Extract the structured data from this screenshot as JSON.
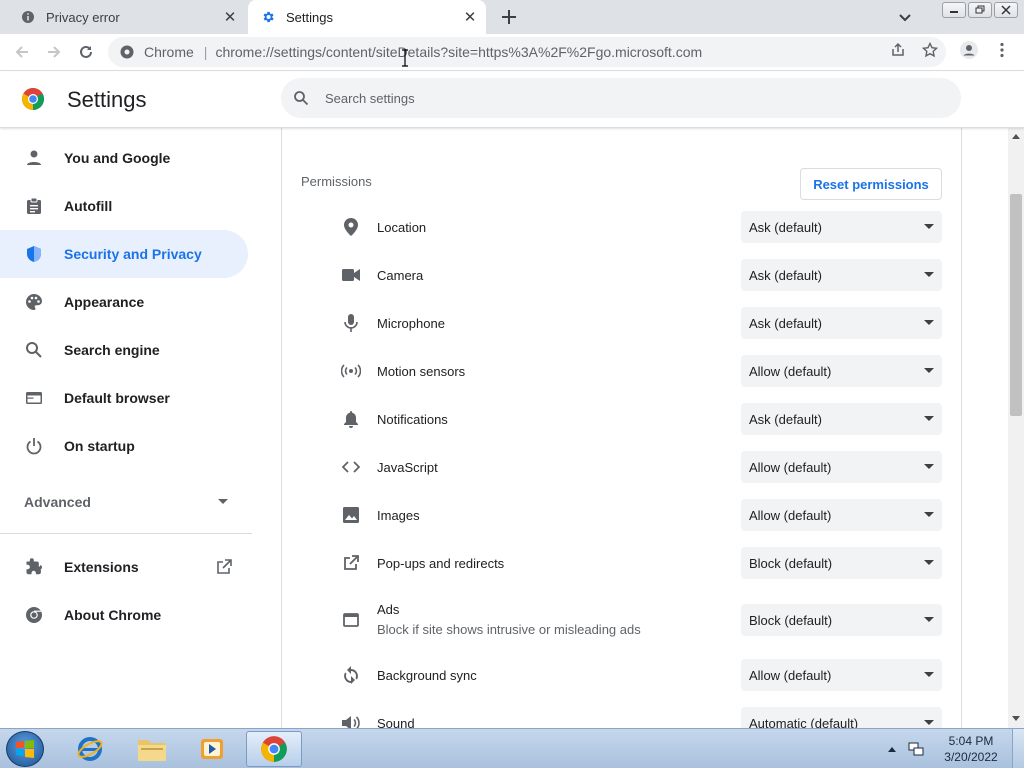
{
  "tabs": [
    {
      "title": "Privacy error",
      "icon": "info-icon",
      "active": false
    },
    {
      "title": "Settings",
      "icon": "gear-icon",
      "active": true
    }
  ],
  "toolbar": {
    "chip": "Chrome",
    "url": "chrome://settings/content/siteDetails?site=https%3A%2F%2Fgo.microsoft.com"
  },
  "header": {
    "title": "Settings",
    "search_placeholder": "Search settings"
  },
  "sidebar": {
    "items": [
      {
        "label": "You and Google",
        "icon": "person-icon",
        "selected": false
      },
      {
        "label": "Autofill",
        "icon": "clipboard-icon",
        "selected": false
      },
      {
        "label": "Security and Privacy",
        "icon": "shield-icon",
        "selected": true
      },
      {
        "label": "Appearance",
        "icon": "palette-icon",
        "selected": false
      },
      {
        "label": "Search engine",
        "icon": "search-icon",
        "selected": false
      },
      {
        "label": "Default browser",
        "icon": "browser-icon",
        "selected": false
      },
      {
        "label": "On startup",
        "icon": "power-icon",
        "selected": false
      }
    ],
    "advanced_label": "Advanced",
    "extensions_label": "Extensions",
    "about_label": "About Chrome"
  },
  "permissions": {
    "header": "Permissions",
    "reset_label": "Reset permissions",
    "rows": [
      {
        "label": "Location",
        "sub": "",
        "value": "Ask (default)",
        "icon": "location-pin-icon"
      },
      {
        "label": "Camera",
        "sub": "",
        "value": "Ask (default)",
        "icon": "camera-icon"
      },
      {
        "label": "Microphone",
        "sub": "",
        "value": "Ask (default)",
        "icon": "microphone-icon"
      },
      {
        "label": "Motion sensors",
        "sub": "",
        "value": "Allow (default)",
        "icon": "sensors-icon"
      },
      {
        "label": "Notifications",
        "sub": "",
        "value": "Ask (default)",
        "icon": "bell-icon"
      },
      {
        "label": "JavaScript",
        "sub": "",
        "value": "Allow (default)",
        "icon": "code-icon"
      },
      {
        "label": "Images",
        "sub": "",
        "value": "Allow (default)",
        "icon": "image-icon"
      },
      {
        "label": "Pop-ups and redirects",
        "sub": "",
        "value": "Block (default)",
        "icon": "external-link-icon"
      },
      {
        "label": "Ads",
        "sub": "Block if site shows intrusive or misleading ads",
        "value": "Block (default)",
        "icon": "ads-window-icon"
      },
      {
        "label": "Background sync",
        "sub": "",
        "value": "Allow (default)",
        "icon": "sync-icon"
      },
      {
        "label": "Sound",
        "sub": "",
        "value": "Automatic (default)",
        "icon": "speaker-icon"
      }
    ]
  },
  "taskbar": {
    "time": "5:04 PM",
    "date": "3/20/2022"
  },
  "colors": {
    "accent": "#1a73e8",
    "selected_bg": "#e8f0fe"
  }
}
